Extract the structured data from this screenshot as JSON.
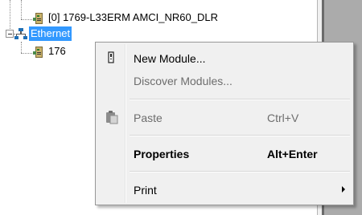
{
  "tree": {
    "items": [
      {
        "label": "[0] 1769-L33ERM AMCI_NR60_DLR",
        "icon": "controller-module-icon"
      },
      {
        "label": "Ethernet",
        "icon": "ethernet-network-icon",
        "selected": true,
        "expanded": true
      },
      {
        "label": "176",
        "icon": "controller-module-icon"
      }
    ]
  },
  "context_menu": {
    "items": [
      {
        "label": "New Module...",
        "shortcut": "",
        "enabled": true,
        "bold": false,
        "icon": "new-module-icon"
      },
      {
        "label": "Discover Modules...",
        "shortcut": "",
        "enabled": false,
        "bold": false
      },
      {
        "label": "Paste",
        "shortcut": "Ctrl+V",
        "enabled": false,
        "bold": false,
        "icon": "paste-icon"
      },
      {
        "label": "Properties",
        "shortcut": "Alt+Enter",
        "enabled": true,
        "bold": true
      },
      {
        "label": "Print",
        "shortcut": "",
        "enabled": true,
        "bold": false,
        "submenu": true
      }
    ]
  },
  "colors": {
    "selection": "#3399ff",
    "menu_background": "#f0f0f0",
    "disabled_text": "#6d6d6d",
    "right_pane": "#ababab"
  }
}
